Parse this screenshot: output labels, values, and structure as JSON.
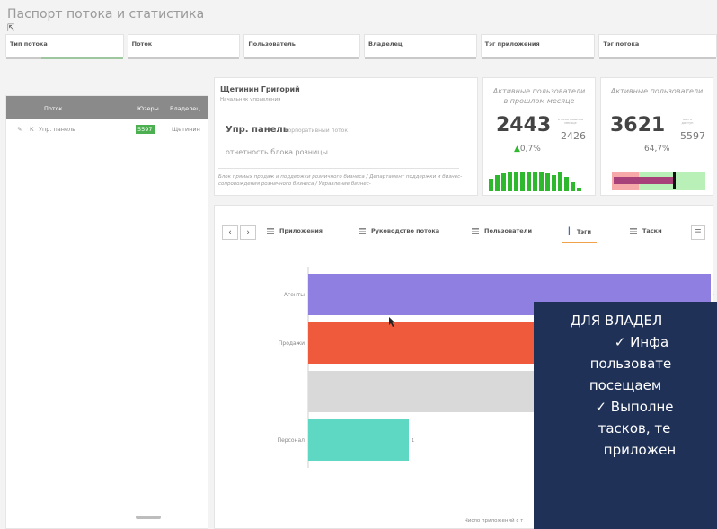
{
  "header": {
    "title": "Паспорт потока и статистика"
  },
  "filters": [
    "Тип потока",
    "Поток",
    "Пользователь",
    "Владелец",
    "Тэг приложения",
    "Тэг потока"
  ],
  "left_table": {
    "columns": [
      "Поток",
      "Юзеры",
      "Владелец"
    ],
    "row": {
      "flag": "К",
      "name": "Упр. панель",
      "users": "5597",
      "owner": "Щетинин"
    }
  },
  "info": {
    "name": "Щетинин Григорий",
    "role": "Начальник управления",
    "app_name": "Упр. панель",
    "app_type": "корпоративный поток",
    "stream": "отчетность блока розницы",
    "path": "Блок прямых продаж и поддержки розничного бизнеса / Департамент поддержки и бизнес-сопровождения розничного бизнеса / Управление бизнес-"
  },
  "kpi1": {
    "title": "Активные пользователи",
    "subtitle": "в прошлом месяце",
    "value": "2443",
    "compare": "2426",
    "note": "в позапрошлом месяце",
    "change": "0,7%"
  },
  "kpi2": {
    "title": "Активные пользователи",
    "value": "3621",
    "total": "5597",
    "note": "всего доступ",
    "pct": "64,7%"
  },
  "tabs": [
    "Приложения",
    "Руководство потока",
    "Пользователи",
    "Тэги",
    "Таски"
  ],
  "colors": {
    "accent": "#f0a24a",
    "green": "#2eb82e",
    "overlay": "#1f3157"
  },
  "chart_data": {
    "type": "bar",
    "orientation": "horizontal",
    "categories": [
      "Агенты",
      "Продажи",
      "-",
      "Персонал"
    ],
    "values": [
      4,
      4,
      4,
      1
    ],
    "colors": [
      "#8e7fe0",
      "#ee5a3b",
      "#d9d9d9",
      "#5ed8c2"
    ],
    "value_labels": [
      "4",
      "",
      "",
      "1"
    ],
    "xlabel": "Число приложений с т"
  },
  "overlay": {
    "lines": [
      "ДЛЯ ВЛАДЕЛ",
      "✓ Инфа",
      "пользовате",
      "посещаем",
      "✓ Выполне",
      "тасков, те",
      "приложен"
    ]
  }
}
